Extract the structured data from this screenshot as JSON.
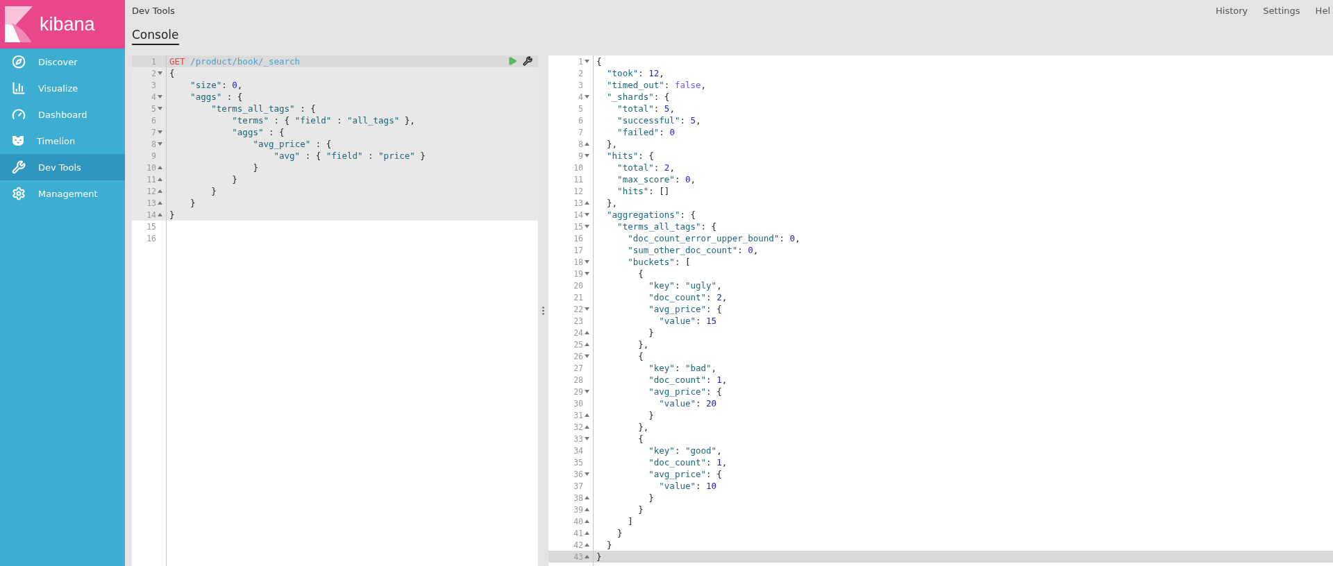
{
  "app": {
    "logo_text": "kibana"
  },
  "sidebar": {
    "items": [
      {
        "label": "Discover",
        "selected": false
      },
      {
        "label": "Visualize",
        "selected": false
      },
      {
        "label": "Dashboard",
        "selected": false
      },
      {
        "label": "Timelion",
        "selected": false
      },
      {
        "label": "Dev Tools",
        "selected": true
      },
      {
        "label": "Management",
        "selected": false
      }
    ]
  },
  "header": {
    "breadcrumb": "Dev Tools",
    "tabs": [
      {
        "label": "Console",
        "selected": true
      }
    ],
    "links": [
      "History",
      "Settings",
      "Hel"
    ]
  },
  "request_editor": {
    "request_lines": [
      {
        "number": "1",
        "fold_start": false,
        "fold_end": false,
        "active": true,
        "code": "GET /product/book/_search"
      },
      {
        "number": "2",
        "fold_start": true,
        "fold_end": false,
        "active": false,
        "code": "{"
      },
      {
        "number": "3",
        "fold_start": false,
        "fold_end": false,
        "active": false,
        "code": "    \"size\": 0,"
      },
      {
        "number": "4",
        "fold_start": true,
        "fold_end": false,
        "active": false,
        "code": "    \"aggs\" : {"
      },
      {
        "number": "5",
        "fold_start": true,
        "fold_end": false,
        "active": false,
        "code": "        \"terms_all_tags\" : {"
      },
      {
        "number": "6",
        "fold_start": false,
        "fold_end": false,
        "active": false,
        "code": "            \"terms\" : { \"field\" : \"all_tags\" },"
      },
      {
        "number": "7",
        "fold_start": true,
        "fold_end": false,
        "active": false,
        "code": "            \"aggs\" : {"
      },
      {
        "number": "8",
        "fold_start": true,
        "fold_end": false,
        "active": false,
        "code": "                \"avg_price\" : {"
      },
      {
        "number": "9",
        "fold_start": false,
        "fold_end": false,
        "active": false,
        "code": "                    \"avg\" : { \"field\" : \"price\" }"
      },
      {
        "number": "10",
        "fold_start": false,
        "fold_end": true,
        "active": false,
        "code": "                }"
      },
      {
        "number": "11",
        "fold_start": false,
        "fold_end": true,
        "active": false,
        "code": "            }"
      },
      {
        "number": "12",
        "fold_start": false,
        "fold_end": true,
        "active": false,
        "code": "        }"
      },
      {
        "number": "13",
        "fold_start": false,
        "fold_end": true,
        "active": false,
        "code": "    }"
      },
      {
        "number": "14",
        "fold_start": false,
        "fold_end": true,
        "active": false,
        "code": "}"
      }
    ],
    "other_lines": [
      {
        "number": "15",
        "fold_start": false,
        "fold_end": false,
        "active": false
      },
      {
        "number": "16",
        "fold_start": false,
        "fold_end": false,
        "active": false
      }
    ]
  },
  "response_editor": {
    "lines": [
      {
        "number": "1",
        "fold_start": true,
        "fold_end": false,
        "active": false,
        "code": "{"
      },
      {
        "number": "2",
        "fold_start": false,
        "fold_end": false,
        "active": false,
        "code": "  \"took\": 12,"
      },
      {
        "number": "3",
        "fold_start": false,
        "fold_end": false,
        "active": false,
        "code": "  \"timed_out\": false,"
      },
      {
        "number": "4",
        "fold_start": true,
        "fold_end": false,
        "active": false,
        "code": "  \"_shards\": {"
      },
      {
        "number": "5",
        "fold_start": false,
        "fold_end": false,
        "active": false,
        "code": "    \"total\": 5,"
      },
      {
        "number": "6",
        "fold_start": false,
        "fold_end": false,
        "active": false,
        "code": "    \"successful\": 5,"
      },
      {
        "number": "7",
        "fold_start": false,
        "fold_end": false,
        "active": false,
        "code": "    \"failed\": 0"
      },
      {
        "number": "8",
        "fold_start": false,
        "fold_end": true,
        "active": false,
        "code": "  },"
      },
      {
        "number": "9",
        "fold_start": true,
        "fold_end": false,
        "active": false,
        "code": "  \"hits\": {"
      },
      {
        "number": "10",
        "fold_start": false,
        "fold_end": false,
        "active": false,
        "code": "    \"total\": 2,"
      },
      {
        "number": "11",
        "fold_start": false,
        "fold_end": false,
        "active": false,
        "code": "    \"max_score\": 0,"
      },
      {
        "number": "12",
        "fold_start": false,
        "fold_end": false,
        "active": false,
        "code": "    \"hits\": []"
      },
      {
        "number": "13",
        "fold_start": false,
        "fold_end": true,
        "active": false,
        "code": "  },"
      },
      {
        "number": "14",
        "fold_start": true,
        "fold_end": false,
        "active": false,
        "code": "  \"aggregations\": {"
      },
      {
        "number": "15",
        "fold_start": true,
        "fold_end": false,
        "active": false,
        "code": "    \"terms_all_tags\": {"
      },
      {
        "number": "16",
        "fold_start": false,
        "fold_end": false,
        "active": false,
        "code": "      \"doc_count_error_upper_bound\": 0,"
      },
      {
        "number": "17",
        "fold_start": false,
        "fold_end": false,
        "active": false,
        "code": "      \"sum_other_doc_count\": 0,"
      },
      {
        "number": "18",
        "fold_start": true,
        "fold_end": false,
        "active": false,
        "code": "      \"buckets\": ["
      },
      {
        "number": "19",
        "fold_start": true,
        "fold_end": false,
        "active": false,
        "code": "        {"
      },
      {
        "number": "20",
        "fold_start": false,
        "fold_end": false,
        "active": false,
        "code": "          \"key\": \"ugly\","
      },
      {
        "number": "21",
        "fold_start": false,
        "fold_end": false,
        "active": false,
        "code": "          \"doc_count\": 2,"
      },
      {
        "number": "22",
        "fold_start": true,
        "fold_end": false,
        "active": false,
        "code": "          \"avg_price\": {"
      },
      {
        "number": "23",
        "fold_start": false,
        "fold_end": false,
        "active": false,
        "code": "            \"value\": 15"
      },
      {
        "number": "24",
        "fold_start": false,
        "fold_end": true,
        "active": false,
        "code": "          }"
      },
      {
        "number": "25",
        "fold_start": false,
        "fold_end": true,
        "active": false,
        "code": "        },"
      },
      {
        "number": "26",
        "fold_start": true,
        "fold_end": false,
        "active": false,
        "code": "        {"
      },
      {
        "number": "27",
        "fold_start": false,
        "fold_end": false,
        "active": false,
        "code": "          \"key\": \"bad\","
      },
      {
        "number": "28",
        "fold_start": false,
        "fold_end": false,
        "active": false,
        "code": "          \"doc_count\": 1,"
      },
      {
        "number": "29",
        "fold_start": true,
        "fold_end": false,
        "active": false,
        "code": "          \"avg_price\": {"
      },
      {
        "number": "30",
        "fold_start": false,
        "fold_end": false,
        "active": false,
        "code": "            \"value\": 20"
      },
      {
        "number": "31",
        "fold_start": false,
        "fold_end": true,
        "active": false,
        "code": "          }"
      },
      {
        "number": "32",
        "fold_start": false,
        "fold_end": true,
        "active": false,
        "code": "        },"
      },
      {
        "number": "33",
        "fold_start": true,
        "fold_end": false,
        "active": false,
        "code": "        {"
      },
      {
        "number": "34",
        "fold_start": false,
        "fold_end": false,
        "active": false,
        "code": "          \"key\": \"good\","
      },
      {
        "number": "35",
        "fold_start": false,
        "fold_end": false,
        "active": false,
        "code": "          \"doc_count\": 1,"
      },
      {
        "number": "36",
        "fold_start": true,
        "fold_end": false,
        "active": false,
        "code": "          \"avg_price\": {"
      },
      {
        "number": "37",
        "fold_start": false,
        "fold_end": false,
        "active": false,
        "code": "            \"value\": 10"
      },
      {
        "number": "38",
        "fold_start": false,
        "fold_end": true,
        "active": false,
        "code": "          }"
      },
      {
        "number": "39",
        "fold_start": false,
        "fold_end": true,
        "active": false,
        "code": "        }"
      },
      {
        "number": "40",
        "fold_start": false,
        "fold_end": true,
        "active": false,
        "code": "      ]"
      },
      {
        "number": "41",
        "fold_start": false,
        "fold_end": true,
        "active": false,
        "code": "    }"
      },
      {
        "number": "42",
        "fold_start": false,
        "fold_end": true,
        "active": false,
        "code": "  }"
      },
      {
        "number": "43",
        "fold_start": false,
        "fold_end": true,
        "active": true,
        "code": "}"
      }
    ]
  }
}
